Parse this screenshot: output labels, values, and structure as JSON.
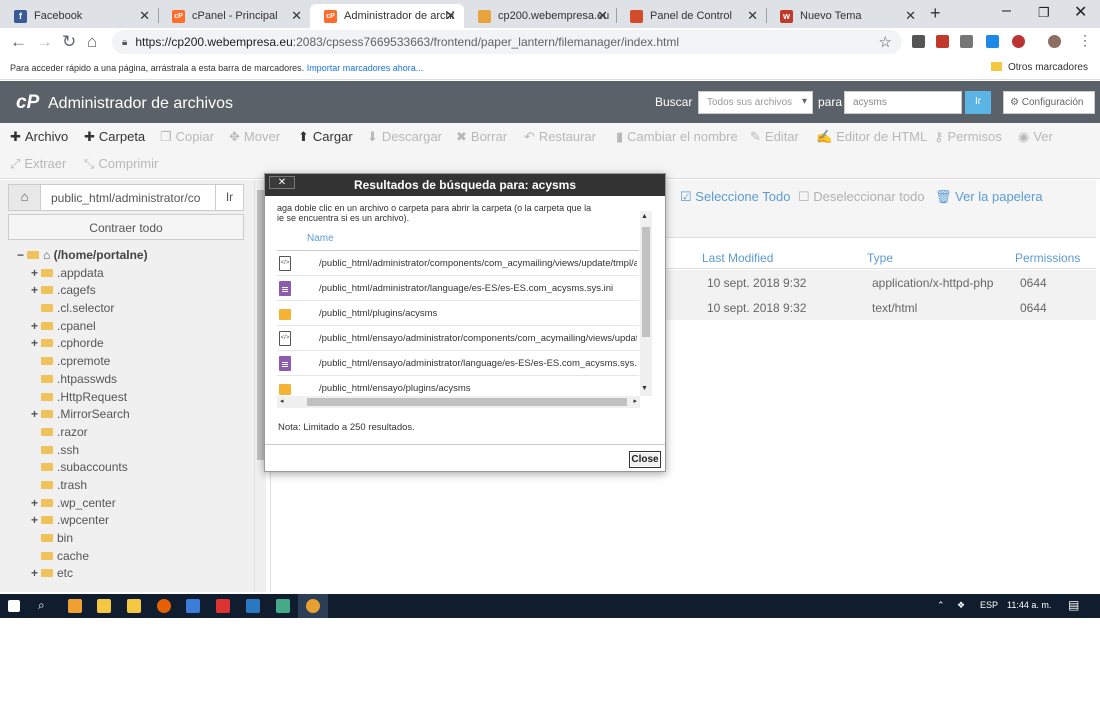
{
  "browser": {
    "tabs": [
      {
        "title": "Facebook",
        "fav": "f",
        "color": "#3b5998"
      },
      {
        "title": "cPanel - Principal",
        "fav": "cP",
        "color": "#ff6c2c"
      },
      {
        "title": "Administrador de archi",
        "fav": "cP",
        "color": "#ff6c2c"
      },
      {
        "title": "cp200.webempresa.eu",
        "fav": "",
        "color": "#e8a33c"
      },
      {
        "title": "Panel de Control",
        "fav": "",
        "color": "#d24b2a"
      },
      {
        "title": "Nuevo Tema",
        "fav": "w",
        "color": "#c0392b"
      }
    ],
    "url_host": "https://cp200.webempresa.eu",
    "url_path": ":2083/cpsess7669533663/frontend/paper_lantern/filemanager/index.html",
    "bookmarks_hint": "Para acceder rápido a una página, arrástrala a esta barra de marcadores.",
    "bookmarks_import": "Importar marcadores ahora...",
    "other_bookmarks": "Otros marcadores"
  },
  "cpanel": {
    "logo": "cP",
    "title": "Administrador de archivos",
    "search_label": "Buscar",
    "search_scope": "Todos sus archivos",
    "para": "para",
    "search_value": "acysms",
    "go": "Ir",
    "settings": "Configuración"
  },
  "toolbar": {
    "archivo": "Archivo",
    "carpeta": "Carpeta",
    "copiar": "Copiar",
    "mover": "Mover",
    "cargar": "Cargar",
    "descargar": "Descargar",
    "borrar": "Borrar",
    "restaurar": "Restaurar",
    "renombrar": "Cambiar el nombre",
    "editar": "Editar",
    "editor_html": "Editor de HTML",
    "permisos": "Permisos",
    "ver": "Ver",
    "extraer": "Extraer",
    "comprimir": "Comprimir"
  },
  "left": {
    "path": "public_html/administrator/co",
    "go": "Ir",
    "collapse": "Contraer todo",
    "root": "(/home/portalne)",
    "tree": [
      {
        "name": ".appdata",
        "plus": true
      },
      {
        "name": ".cagefs",
        "plus": true
      },
      {
        "name": ".cl.selector",
        "plus": false
      },
      {
        "name": ".cpanel",
        "plus": true
      },
      {
        "name": ".cphorde",
        "plus": true
      },
      {
        "name": ".cpremote",
        "plus": false
      },
      {
        "name": ".htpasswds",
        "plus": false
      },
      {
        "name": ".HttpRequest",
        "plus": false
      },
      {
        "name": ".MirrorSearch",
        "plus": true
      },
      {
        "name": ".razor",
        "plus": false
      },
      {
        "name": ".ssh",
        "plus": false
      },
      {
        "name": ".subaccounts",
        "plus": false
      },
      {
        "name": ".trash",
        "plus": false
      },
      {
        "name": ".wp_center",
        "plus": true
      },
      {
        "name": ".wpcenter",
        "plus": true
      },
      {
        "name": "bin",
        "plus": false
      },
      {
        "name": "cache",
        "plus": false
      },
      {
        "name": "etc",
        "plus": true
      }
    ]
  },
  "actions": {
    "select_all": "Seleccione Todo",
    "deselect_all": "Deseleccionar todo",
    "trash": "Ver la papelera"
  },
  "table": {
    "headers": {
      "modified": "Last Modified",
      "type": "Type",
      "perms": "Permissions"
    },
    "rows": [
      {
        "modified": "10 sept. 2018 9:32",
        "type": "application/x-httpd-php",
        "perms": "0644"
      },
      {
        "modified": "10 sept. 2018 9:32",
        "type": "text/html",
        "perms": "0644"
      }
    ]
  },
  "dialog": {
    "title": "Resultados de búsqueda para: acysms",
    "close_x": "✕",
    "instructions": "aga doble clic en un archivo o carpeta para abrir la carpeta (o la carpeta que la\nie se encuentra si es un archivo).",
    "name_header": "Name",
    "results": [
      {
        "icon": "code",
        "path": "/public_html/administrator/components/com_acymailing/views/update/tmpl/acysms.php"
      },
      {
        "icon": "doc",
        "path": "/public_html/administrator/language/es-ES/es-ES.com_acysms.sys.ini"
      },
      {
        "icon": "folder",
        "path": "/public_html/plugins/acysms"
      },
      {
        "icon": "code",
        "path": "/public_html/ensayo/administrator/components/com_acymailing/views/update/tmpl"
      },
      {
        "icon": "doc",
        "path": "/public_html/ensayo/administrator/language/es-ES/es-ES.com_acysms.sys.ini"
      },
      {
        "icon": "folder",
        "path": "/public_html/ensayo/plugins/acysms"
      }
    ],
    "note": "Nota: Limitado a 250 resultados.",
    "close": "Close"
  },
  "taskbar": {
    "lang": "ESP",
    "time": "11:44 a. m."
  }
}
